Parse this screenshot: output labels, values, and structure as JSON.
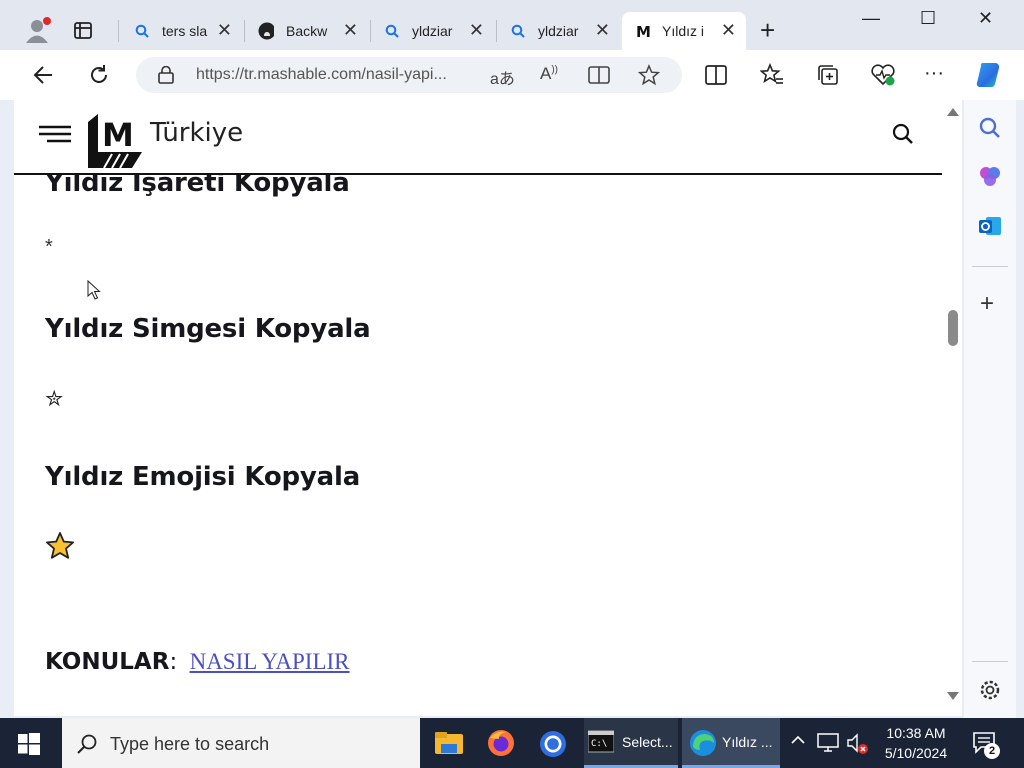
{
  "browser": {
    "tabs": [
      {
        "label": "ters sla",
        "icon": "search-icon"
      },
      {
        "label": "Backw",
        "icon": "github-icon"
      },
      {
        "label": "yldziar",
        "icon": "search-icon"
      },
      {
        "label": "yldziar",
        "icon": "search-icon"
      },
      {
        "label": "Yıldız i",
        "icon": "mashable-icon",
        "active": true
      }
    ],
    "new_tab": "+",
    "url": "https://tr.mashable.com/nasil-yapi...",
    "window_controls": {
      "minimize": "—",
      "maximize": "☐",
      "close": "✕"
    }
  },
  "site": {
    "logo_letter": "M",
    "logo_text": "Türkiye"
  },
  "article": {
    "sections": [
      {
        "heading": "Yıldız İşareti Kopyala",
        "symbol": "*"
      },
      {
        "heading": "Yıldız Simgesi Kopyala",
        "symbol": "✮"
      },
      {
        "heading": "Yıldız Emojisi Kopyala",
        "symbol": "⭐"
      }
    ],
    "topics_label": "KONULAR",
    "topics_colon": ":",
    "topics_link": "NASIL YAPILIR"
  },
  "taskbar": {
    "search_placeholder": "Type here to search",
    "apps": [
      {
        "label": "Select..."
      },
      {
        "label": "Yıldız ..."
      }
    ],
    "time": "10:38 AM",
    "date": "5/10/2024",
    "notification_count": "2"
  },
  "colors": {
    "link": "#4b4fc4",
    "taskbar": "#1a2436",
    "heading": "#15171c"
  }
}
